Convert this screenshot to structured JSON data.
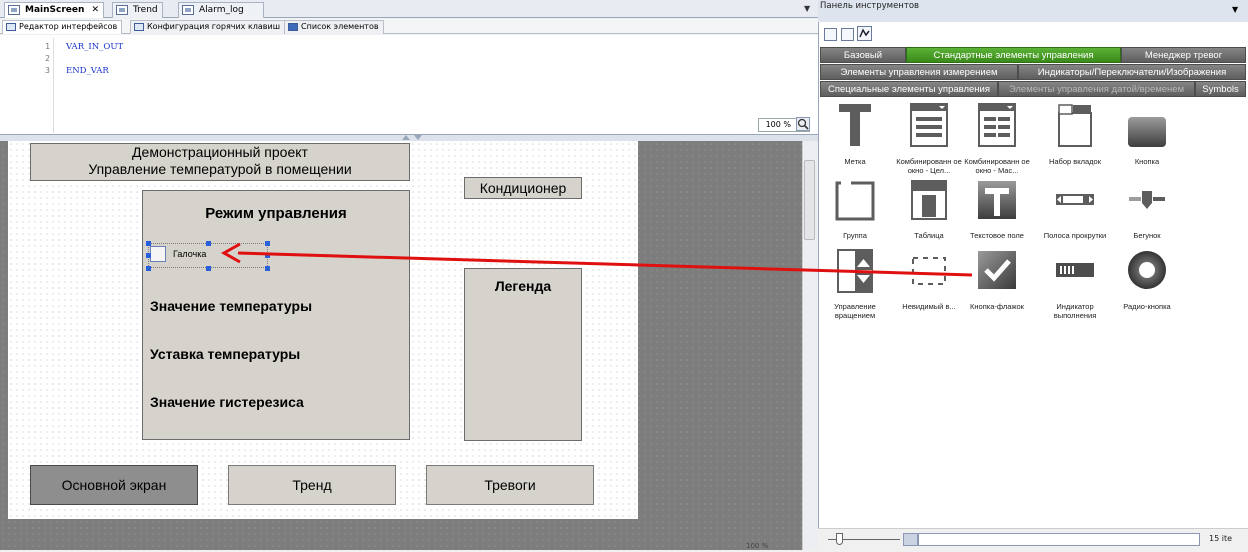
{
  "doc_tabs": [
    {
      "label": "MainScreen",
      "active": true,
      "closable": true
    },
    {
      "label": "Trend",
      "active": false
    },
    {
      "label": "Alarm_log",
      "active": false
    }
  ],
  "sub_tabs": [
    {
      "label": "Редактор интерфейсов",
      "active": true
    },
    {
      "label": "Конфигурация горячих клавиш",
      "active": false
    },
    {
      "label": "Список элементов",
      "active": false
    }
  ],
  "code": {
    "lines": [
      {
        "num": "1",
        "text": "VAR_IN_OUT"
      },
      {
        "num": "2",
        "text": ""
      },
      {
        "num": "3",
        "text": "END_VAR"
      }
    ],
    "zoom": "100 %"
  },
  "canvas": {
    "title_line1": "Демонстрационный проект",
    "title_line2": "Управление температурой в помещении",
    "mode_title": "Режим управления",
    "checkbox_label": "Галочка",
    "temp_value": "Значение температуры",
    "temp_setpoint": "Уставка температуры",
    "hysteresis": "Значение гистерезиса",
    "air_conditioner": "Кондиционер",
    "legend": "Легенда",
    "btn_main": "Основной экран",
    "btn_trend": "Тренд",
    "btn_alarms": "Тревоги",
    "zoom_bottom": "100 %"
  },
  "toolbox": {
    "title": "Панель инструментов",
    "categories_row1": [
      "Базовый",
      "Стандартные элементы управления",
      "Менеджер тревог"
    ],
    "categories_row2": [
      "Элементы управления измерением",
      "Индикаторы/Переключатели/Изображения"
    ],
    "categories_row3": [
      "Специальные элементы управления",
      "Элементы управления датой/временем",
      "Symbols"
    ],
    "items": [
      {
        "name": "Метка",
        "icon": "label-icon"
      },
      {
        "name": "Комбинированн ое окно - Цел...",
        "icon": "combo-int-icon"
      },
      {
        "name": "Комбинированн ое окно - Мас...",
        "icon": "combo-array-icon"
      },
      {
        "name": "Набор вкладок",
        "icon": "tab-control-icon"
      },
      {
        "name": "Кнопка",
        "icon": "button-icon"
      },
      {
        "name": "Группа",
        "icon": "group-icon"
      },
      {
        "name": "Таблица",
        "icon": "table-icon"
      },
      {
        "name": "Текстовое поле",
        "icon": "text-field-icon"
      },
      {
        "name": "Полоса прокрутки",
        "icon": "scrollbar-icon"
      },
      {
        "name": "Бегунок",
        "icon": "slider-icon"
      },
      {
        "name": "Управление вращением",
        "icon": "spin-control-icon"
      },
      {
        "name": "Невидимый в...",
        "icon": "invisible-input-icon"
      },
      {
        "name": "Кнопка-флажок",
        "icon": "checkbox-icon"
      },
      {
        "name": "Индикатор выполнения",
        "icon": "progress-bar-icon"
      },
      {
        "name": "Радио-кнопка",
        "icon": "radio-button-icon"
      }
    ],
    "item_count": "15 ite"
  },
  "colors": {
    "accent_green": "#4aa12a",
    "arrow_red": "#e01010",
    "selection_blue": "#2a5fdc"
  }
}
